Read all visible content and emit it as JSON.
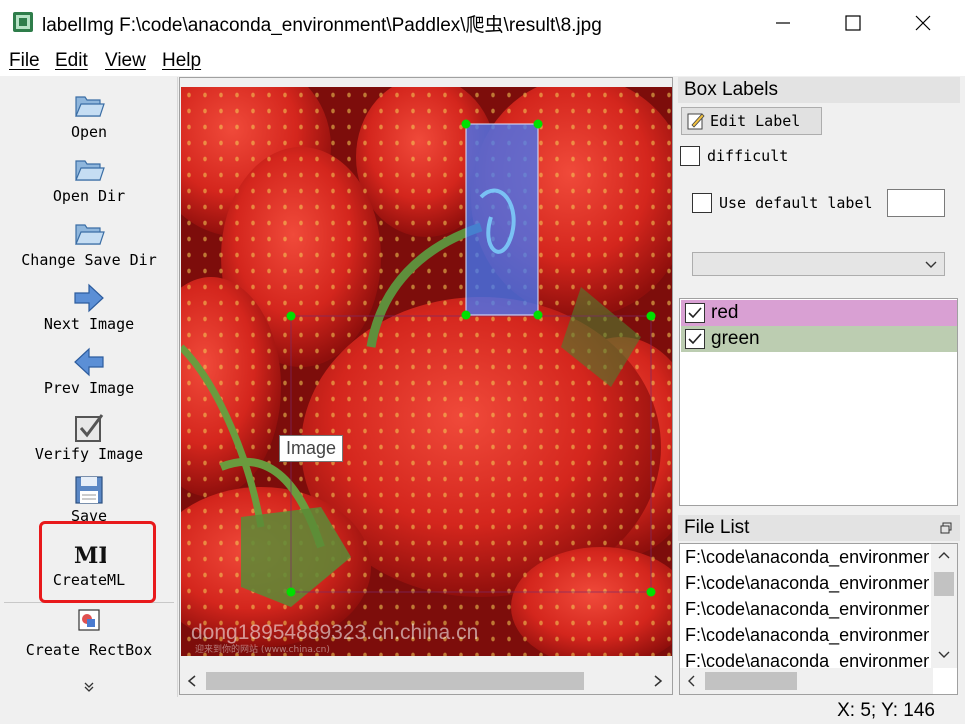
{
  "window": {
    "title": "labelImg F:\\code\\anaconda_environment\\Paddlex\\爬虫\\result\\8.jpg",
    "icons": [
      "app-icon",
      "minimize-icon",
      "maximize-icon",
      "close-icon"
    ]
  },
  "menu": [
    "File",
    "Edit",
    "View",
    "Help"
  ],
  "toolbar": {
    "items": [
      {
        "label": "Open",
        "icon": "folder-open-icon"
      },
      {
        "label": "Open Dir",
        "icon": "folder-open-icon"
      },
      {
        "label": "Change Save Dir",
        "icon": "folder-open-icon"
      },
      {
        "label": "Next Image",
        "icon": "arrow-right-icon"
      },
      {
        "label": "Prev Image",
        "icon": "arrow-left-icon"
      },
      {
        "label": "Verify Image",
        "icon": "checkbox-icon"
      },
      {
        "label": "Save",
        "icon": "floppy-icon"
      },
      {
        "label": "CreateML",
        "icon": "createml-icon"
      },
      {
        "label": "Create RectBox",
        "icon": "rectbox-icon"
      }
    ],
    "more_icon": "double-chevron-down-icon"
  },
  "canvas": {
    "tooltip": "Image",
    "watermark": "dong18954889323.cn.china.cn",
    "watermark_small": "迎来到你的网站 (www.china.cn)"
  },
  "box_labels": {
    "title": "Box Labels",
    "edit_label_button": "Edit Label",
    "difficult_label": "difficult",
    "difficult_checked": false,
    "use_default_label": "Use default label",
    "use_default_checked": false,
    "default_label_value": "",
    "dropdown_value": "",
    "labels": [
      {
        "name": "red",
        "checked": true,
        "color": "#d9a0d3"
      },
      {
        "name": "green",
        "checked": true,
        "color": "#bccdb1"
      }
    ]
  },
  "file_list": {
    "title": "File List",
    "files": [
      "F:\\code\\anaconda_environment",
      "F:\\code\\anaconda_environment",
      "F:\\code\\anaconda_environment",
      "F:\\code\\anaconda_environment",
      "F:\\code\\anaconda_environment"
    ]
  },
  "status": "X: 5; Y: 146",
  "colors": {
    "highlight": "#e8191b",
    "vertex": "#00e000",
    "box_fill": "#3d7bff"
  }
}
